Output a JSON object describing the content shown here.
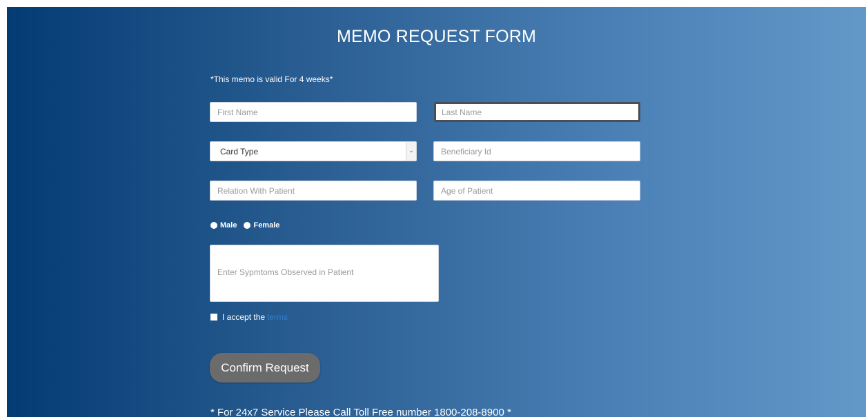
{
  "form": {
    "title": "MEMO REQUEST FORM",
    "validity_note": "*This memo is valid For 4 weeks*",
    "first_name_placeholder": "First Name",
    "last_name_placeholder": "Last Name",
    "card_type_selected": "Card Type",
    "beneficiary_id_placeholder": "Beneficiary Id",
    "relation_placeholder": "Relation With Patient",
    "age_placeholder": "Age of Patient",
    "gender_options": [
      "Male",
      "Female"
    ],
    "symptoms_placeholder": "Enter Sypmtoms Observed in Patient",
    "terms_text": "I accept the",
    "terms_link": "terms",
    "confirm_label": "Confirm Request",
    "footer_note": "* For 24x7 Service Please Call Toll Free number 1800-208-8900 *"
  },
  "icons": {
    "select_arrow": "chevron-down-icon"
  },
  "colors": {
    "gradient_start": "#033b73",
    "gradient_end": "#6398c9",
    "button_bg": "#6b6b6b",
    "link": "#2f7fd6"
  }
}
